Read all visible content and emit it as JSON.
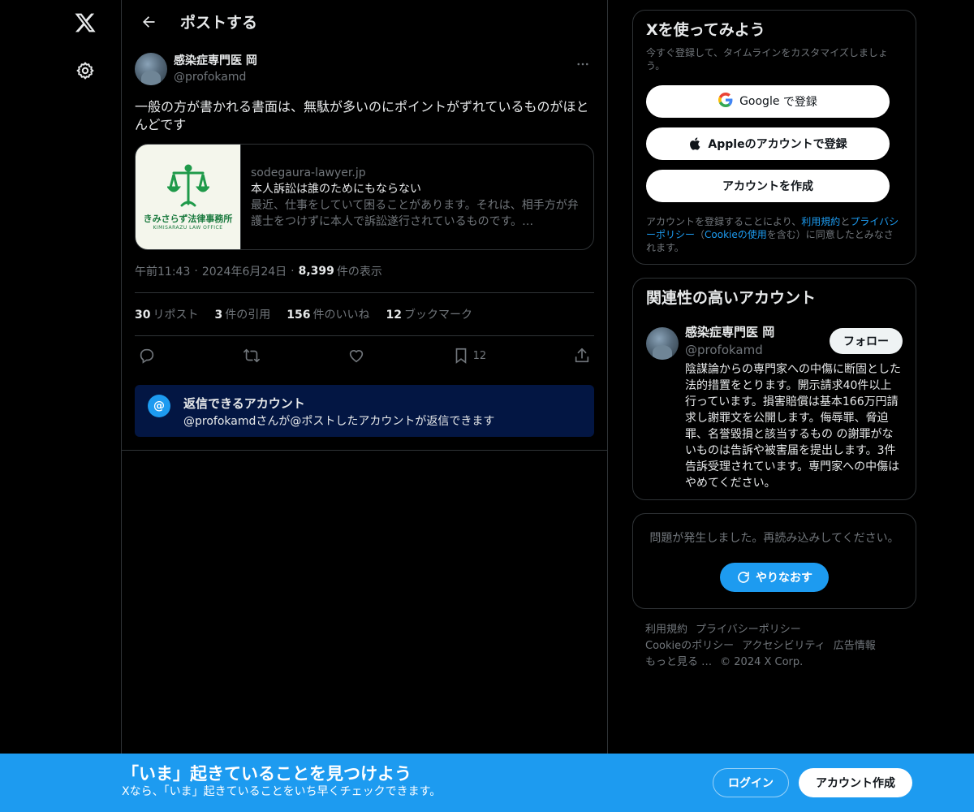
{
  "header": {
    "title": "ポストする"
  },
  "post": {
    "author_name": "感染症専門医 岡",
    "author_handle": "@profokamd",
    "text": "一般の方が書かれる書面は、無駄が多いのにポイントがずれているものがほとんどです",
    "card": {
      "logo_text": "きみさらず法律事務所",
      "logo_sub": "KIMISARAZU LAW OFFICE",
      "domain": "sodegaura-lawyer.jp",
      "title": "本人訴訟は誰のためにもならない",
      "description": "最近、仕事をしていて困ることがあります。それは、相手方が弁護士をつけずに本人で訴訟遂行されているものです。…"
    },
    "time": "午前11:43",
    "date": "2024年6月24日",
    "views_count": "8,399",
    "views_label": "件の表示",
    "separator": "·",
    "stats": {
      "reposts_count": "30",
      "reposts_label": "リポスト",
      "quotes_count": "3",
      "quotes_label": "件の引用",
      "likes_count": "156",
      "likes_label": "件のいいね",
      "bookmarks_count": "12",
      "bookmarks_label": "ブックマーク"
    },
    "bookmark_action_count": "12",
    "reply_box": {
      "icon_text": "@",
      "title": "返信できるアカウント",
      "subtitle": "@profokamdさんが@ポストしたアカウントが返信できます"
    }
  },
  "signup": {
    "title": "Xを使ってみよう",
    "subtitle": "今すぐ登録して、タイムラインをカスタマイズしましょう。",
    "google_g": "G",
    "google_label_brand": "Google",
    "google_label_rest": " で登録",
    "apple_label": "Appleのアカウントで登録",
    "create_label": "アカウントを作成",
    "legal_prefix": "アカウントを登録することにより、",
    "legal_terms": "利用規約",
    "legal_and": "と",
    "legal_privacy": "プライバシーポリシー",
    "legal_mid": "（",
    "legal_cookie": "Cookieの使用",
    "legal_suffix": "を含む）に同意したとみなされます。"
  },
  "related": {
    "title": "関連性の高いアカウント",
    "name": "感染症専門医 岡",
    "handle": "@profokamd",
    "follow_label": "フォロー",
    "bio": "陰謀論からの専門家への中傷に断固とした法的措置をとります。開示請求40件以上行っています。損害賠償は基本166万円請求し謝罪文を公開します。侮辱罪、脅迫罪、名誉毀損と該当するもの の謝罪がないものは告訴や被害届を提出します。3件告訴受理されています。専門家への中傷はやめてください。"
  },
  "error": {
    "message": "問題が発生しました。再読み込みしてください。",
    "retry_label": "やりなおす"
  },
  "footer": {
    "links": [
      "利用規約",
      "プライバシーポリシー",
      "Cookieのポリシー",
      "アクセシビリティ",
      "広告情報",
      "もっと見る …"
    ],
    "copyright": "© 2024 X Corp."
  },
  "bottom_bar": {
    "title": "「いま」起きていることを見つけよう",
    "subtitle": "Xなら、「いま」起きていることをいち早くチェックできます。",
    "login_label": "ログイン",
    "signup_label": "アカウント作成"
  },
  "colors": {
    "accent": "#1d9bf0",
    "background": "#000000",
    "border": "#2f3336",
    "muted": "#71767b",
    "reply_box": "#031643",
    "logo_green": "#1a7a3e"
  },
  "icons": {
    "logo": "x-logo-icon",
    "settings": "gear-icon",
    "back": "arrow-left-icon",
    "more": "more-icon",
    "reply": "reply-icon",
    "repost": "repost-icon",
    "like": "heart-icon",
    "bookmark": "bookmark-icon",
    "share": "share-icon",
    "apple": "apple-icon",
    "google": "google-icon",
    "refresh": "refresh-icon"
  }
}
